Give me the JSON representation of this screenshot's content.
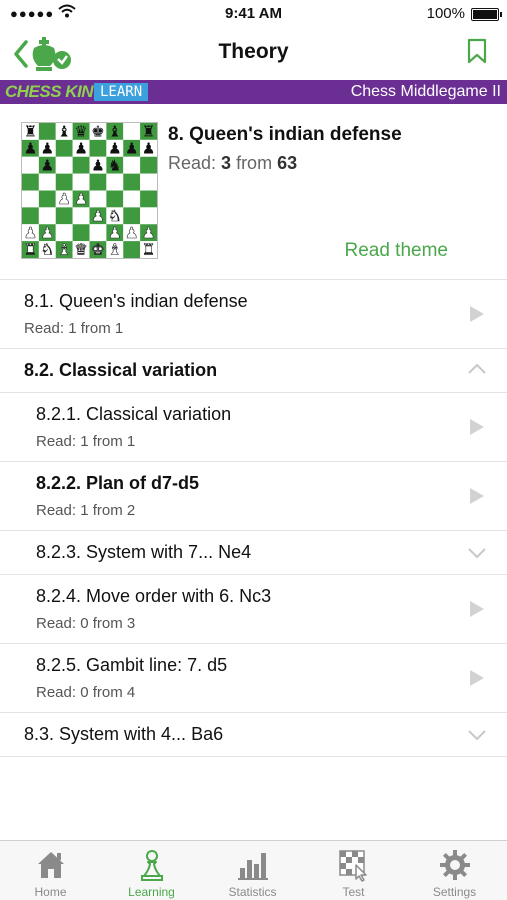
{
  "status": {
    "time": "9:41 AM",
    "battery": "100%",
    "signal": "●●●●●"
  },
  "nav": {
    "title": "Theory"
  },
  "banner": {
    "brand": "CHESS KING",
    "learn": "LEARN",
    "course": "Chess Middlegame II"
  },
  "chapter": {
    "title": "8. Queen's indian defense",
    "progress_prefix": "Read: ",
    "progress_read": "3",
    "progress_mid": " from ",
    "progress_total": "63",
    "read_theme": "Read theme"
  },
  "items": [
    {
      "title": "8.1. Queen's indian defense",
      "sub": "Read: 1 from 1"
    },
    {
      "title": "8.2. Classical variation"
    },
    {
      "title": "8.2.1. Classical variation",
      "sub": "Read: 1 from 1"
    },
    {
      "title": "8.2.2. Plan of d7-d5",
      "sub": "Read: 1 from 2"
    },
    {
      "title": "8.2.3. System with 7... Ne4"
    },
    {
      "title": "8.2.4. Move order with 6. Nc3",
      "sub": "Read: 0 from 3"
    },
    {
      "title": "8.2.5. Gambit line: 7. d5",
      "sub": "Read: 0 from 4"
    },
    {
      "title": "8.3. System with 4... Ba6"
    }
  ],
  "tabs": [
    {
      "label": "Home",
      "icon": "home-icon"
    },
    {
      "label": "Learning",
      "icon": "pawn-icon"
    },
    {
      "label": "Statistics",
      "icon": "bar-chart-icon"
    },
    {
      "label": "Test",
      "icon": "chessboard-cursor-icon"
    },
    {
      "label": "Settings",
      "icon": "gear-icon"
    }
  ],
  "colors": {
    "accent": "#4aa84a",
    "banner": "#6b2f94",
    "learn_badge": "#3da0de",
    "board_dark": "#3f9a3f"
  },
  "board": {
    "rows": [
      "r.bqkb.r",
      "pp.p.ppp",
      ".p..pn..",
      "........",
      "..PP....",
      "....PN..",
      "PP...PPP",
      "RNBQKB.R"
    ]
  }
}
